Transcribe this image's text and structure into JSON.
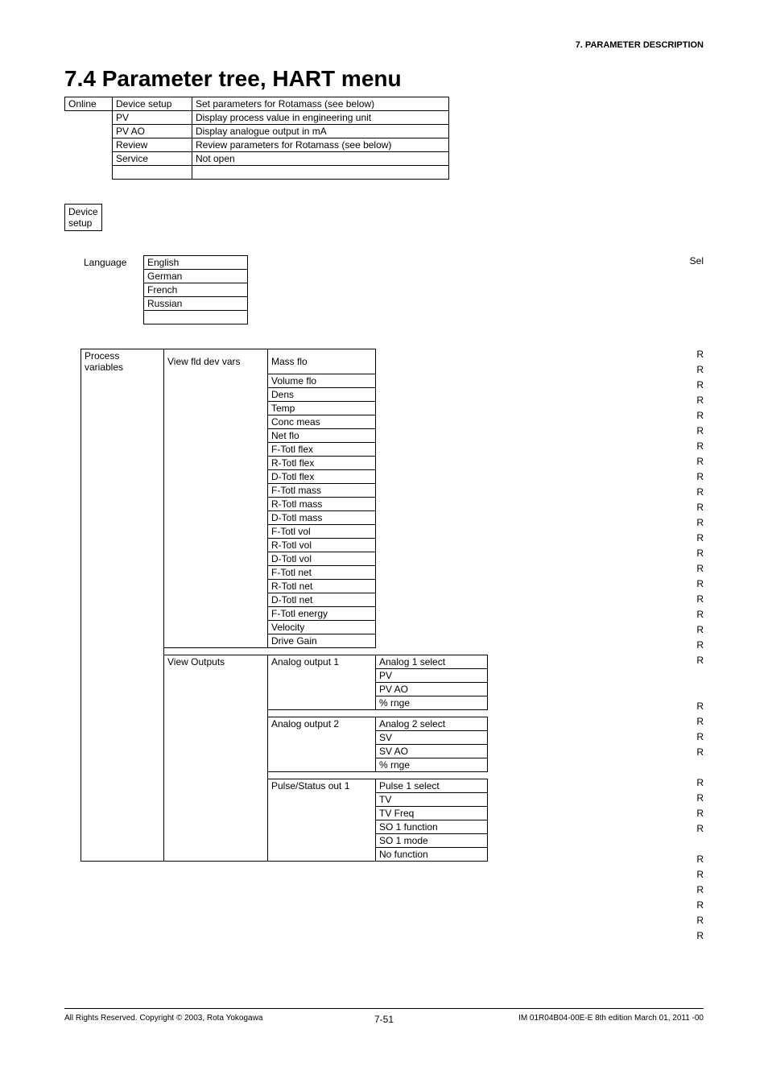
{
  "header": {
    "right": "7.  PARAMETER DESCRIPTION"
  },
  "title": "7.4  Parameter tree, HART menu",
  "top_table": {
    "c0": "Online",
    "rows": [
      {
        "c1": "Device setup",
        "c2": "Set parameters for Rotamass (see below)"
      },
      {
        "c1": "PV",
        "c2": "Display process value in engineering unit"
      },
      {
        "c1": "PV AO",
        "c2": "Display analogue output in mA"
      },
      {
        "c1": "Review",
        "c2": "Review parameters for Rotamass (see below)"
      },
      {
        "c1": "Service",
        "c2": "Not open"
      },
      {
        "c1": "",
        "c2": ""
      }
    ]
  },
  "device_setup_box": "Device\nsetup",
  "language": {
    "label": "Language",
    "items": [
      "English",
      "German",
      "French",
      "Russian",
      ""
    ],
    "flag": "Sel"
  },
  "proc_vars": {
    "label": "Process\nvariables",
    "group1_label": "View fld dev vars",
    "group1_items": [
      "Mass flo",
      "Volume flo",
      "Dens",
      "Temp",
      "Conc meas",
      "Net flo",
      "F-Totl flex",
      "R-Totl flex",
      "D-Totl flex",
      "F-Totl mass",
      "R-Totl mass",
      "D-Totl mass",
      "F-Totl vol",
      "R-Totl vol",
      "D-Totl vol",
      "F-Totl net",
      "R-Totl net",
      "D-Totl net",
      "F-Totl energy",
      "Velocity",
      "Drive Gain"
    ],
    "group1_flags": [
      "R",
      "R",
      "R",
      "R",
      "R",
      "R",
      "R",
      "R",
      "R",
      "R",
      "R",
      "R",
      "R",
      "R",
      "R",
      "R",
      "R",
      "R",
      "R",
      "R",
      "R"
    ],
    "group2_label": "View Outputs",
    "out1_label": "Analog output 1",
    "out1_items": [
      "Analog 1 select",
      "PV",
      "PV AO",
      "% rnge"
    ],
    "out1_flags": [
      "R",
      "R",
      "R",
      "R"
    ],
    "out2_label": "Analog output 2",
    "out2_items": [
      "Analog 2 select",
      "SV",
      "SV AO",
      "% rnge"
    ],
    "out2_flags": [
      "R",
      "R",
      "R",
      "R"
    ],
    "out3_label": "Pulse/Status out 1",
    "out3_items": [
      "Pulse 1 select",
      "TV",
      "TV Freq",
      "SO 1 function",
      "SO 1 mode",
      "No function"
    ],
    "out3_flags": [
      "R",
      "R",
      "R",
      "R",
      "R",
      "R"
    ]
  },
  "footer": {
    "left": "All Rights Reserved. Copyright © 2003, Rota Yokogawa",
    "mid": "7-51",
    "right": "IM 01R04B04-00E-E  8th edition March 01, 2011 -00"
  }
}
